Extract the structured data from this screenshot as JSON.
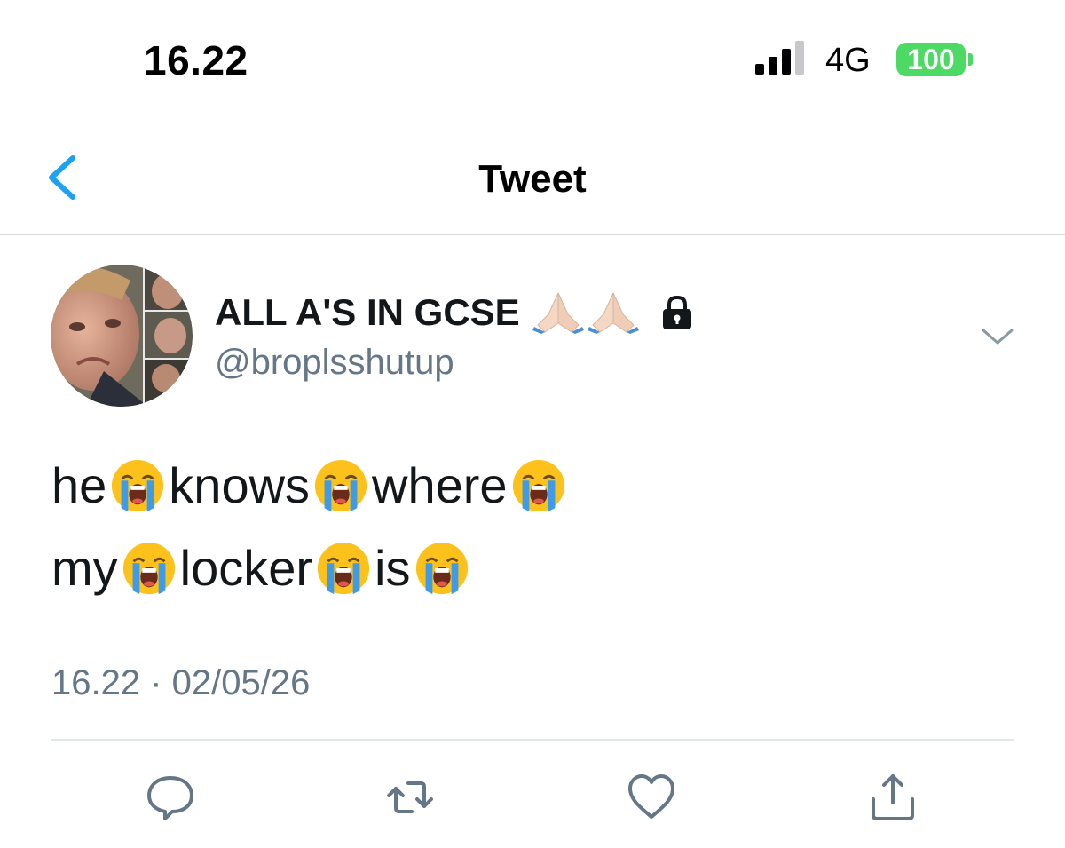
{
  "status_bar": {
    "time": "16.22",
    "network": "4G",
    "battery": "100"
  },
  "nav": {
    "title": "Tweet",
    "back_icon": "chevron-left-icon"
  },
  "tweet": {
    "author": {
      "display_name": "ALL A'S IN GCSE",
      "name_emoji": [
        "folded-hands",
        "folded-hands"
      ],
      "protected_icon": "lock-icon",
      "handle": "@broplsshutup"
    },
    "lines": [
      {
        "words": [
          "he",
          "knows",
          "where"
        ],
        "emoji": "loudly-crying-face"
      },
      {
        "words": [
          "my",
          "locker",
          "is"
        ],
        "emoji": "loudly-crying-face"
      }
    ],
    "timestamp": "16.22 · 02/05/26"
  },
  "actions": {
    "reply_icon": "reply-icon",
    "retweet_icon": "retweet-icon",
    "like_icon": "heart-icon",
    "share_icon": "share-icon"
  },
  "colors": {
    "accent": "#1da1f2",
    "text": "#14171a",
    "secondary_text": "#657786",
    "icon_gray": "#657786",
    "battery_green": "#4cd964",
    "divider": "#e1e8ed"
  }
}
